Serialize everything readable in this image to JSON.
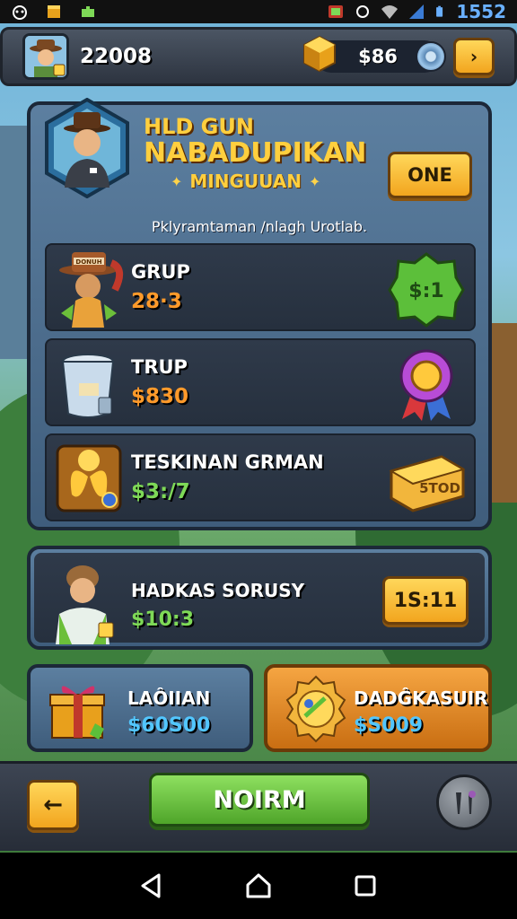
{
  "status_bar": {
    "time": "1552",
    "icons": [
      "alien-icon",
      "box-icon",
      "puzzle-icon",
      "battery-saver-icon",
      "sync-icon",
      "wifi-icon",
      "signal-icon",
      "battery-icon"
    ]
  },
  "top_bar": {
    "score": "22008",
    "currency": "$86",
    "arrow_label": "›"
  },
  "main_panel": {
    "title_line1": "HLD GUN",
    "title_line2": "NABADUPIKAN",
    "subtitle": "MINGUUAN",
    "one_button": "ONE",
    "description": "Pklyramtaman /nlagh Urotlab.",
    "items": [
      {
        "name": "GRUP",
        "price": "28·3",
        "hat_text": "DONUH",
        "reward_label": "$:1"
      },
      {
        "name": "TRUP",
        "price": "$830",
        "reward_label": ""
      },
      {
        "name": "TESKINAN GRMAN",
        "price": "$3:/7",
        "reward_label": "5TOD"
      }
    ]
  },
  "offer": {
    "name": "HADKAS SORUSY",
    "price": "$10:3",
    "button": "1S:11"
  },
  "cards": {
    "left": {
      "name": "LAÔIIAN",
      "price": "$60S00"
    },
    "right": {
      "name": "DADĜKASUIR",
      "price": "$S009"
    }
  },
  "action_bar": {
    "back_label": "←",
    "confirm_label": "NOIRM"
  },
  "colors": {
    "gold_title": "#ffcf3e",
    "green_price": "#7ed957",
    "orange_price": "#ff9a2a",
    "blue_price": "#52c6ff",
    "panel_blue": "#4f6f8f",
    "confirm_green": "#6cc340"
  }
}
